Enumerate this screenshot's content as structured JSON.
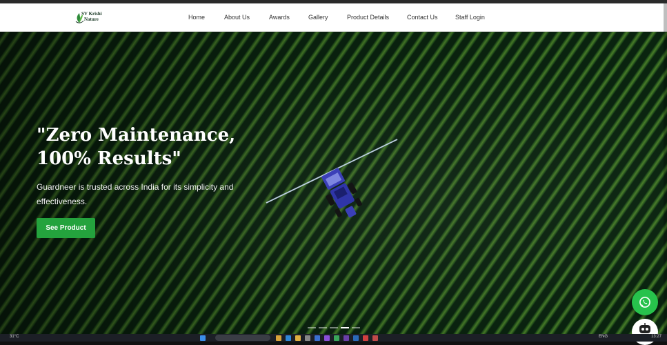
{
  "brand": {
    "line1": "SV Krishi",
    "line2": "Nature"
  },
  "nav": {
    "items": [
      {
        "label": "Home"
      },
      {
        "label": "About Us"
      },
      {
        "label": "Awards"
      },
      {
        "label": "Gallery"
      },
      {
        "label": "Product Details"
      },
      {
        "label": "Contact Us"
      },
      {
        "label": "Staff Login"
      }
    ]
  },
  "hero": {
    "headline_line1": "\"Zero Maintenance,",
    "headline_line2": "100% Results\"",
    "subtext": "Guardneer is trusted across India for its simplicity and effectiveness.",
    "cta_label": "See Product"
  },
  "taskbar": {
    "weather": "31°C",
    "language": "ENG",
    "time": "13:27"
  },
  "colors": {
    "accent_green": "#24a33d",
    "whatsapp_green": "#27c24c",
    "nav_bg": "#ffffff"
  }
}
